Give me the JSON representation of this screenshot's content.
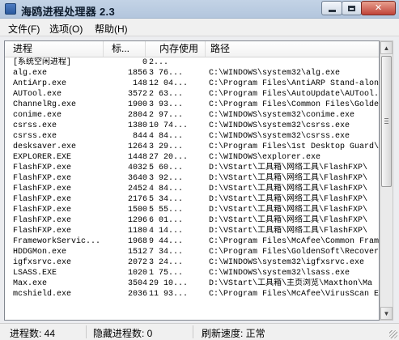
{
  "window": {
    "title": "海鸥进程处理器 2.3",
    "controls": {
      "minimize": "",
      "maximize": "",
      "close": "✕"
    }
  },
  "menu": {
    "file": "文件(F)",
    "options": "选项(O)",
    "help": "帮助(H)"
  },
  "columns": {
    "process": "进程",
    "pid": "标...",
    "memory": "内存使用",
    "path": "路径"
  },
  "rows": [
    {
      "name": "[系统空闲进程]",
      "pid": "0",
      "mem": "2...",
      "path": ""
    },
    {
      "name": "alg.exe",
      "pid": "1856",
      "mem": "3 76...",
      "path": "C:\\WINDOWS\\system32\\alg.exe"
    },
    {
      "name": "AntiArp.exe",
      "pid": "148",
      "mem": "12 04...",
      "path": "C:\\Program Files\\AntiARP Stand-alon"
    },
    {
      "name": "AUTool.exe",
      "pid": "3572",
      "mem": "2 63...",
      "path": "C:\\Program Files\\AutoUpdate\\AUTool."
    },
    {
      "name": "ChannelRg.exe",
      "pid": "1900",
      "mem": "3 93...",
      "path": "C:\\Program Files\\Common Files\\Golden"
    },
    {
      "name": "conime.exe",
      "pid": "2804",
      "mem": "2 97...",
      "path": "C:\\WINDOWS\\system32\\conime.exe"
    },
    {
      "name": "csrss.exe",
      "pid": "1380",
      "mem": "10 74...",
      "path": "C:\\WINDOWS\\system32\\csrss.exe"
    },
    {
      "name": "csrss.exe",
      "pid": "844",
      "mem": "4 84...",
      "path": "C:\\WINDOWS\\system32\\csrss.exe"
    },
    {
      "name": "desksaver.exe",
      "pid": "1264",
      "mem": "3 29...",
      "path": "C:\\Program Files\\1st Desktop Guard\\"
    },
    {
      "name": "EXPLORER.EXE",
      "pid": "1448",
      "mem": "27 20...",
      "path": "C:\\WINDOWS\\explorer.exe"
    },
    {
      "name": "FlashFXP.exe",
      "pid": "4032",
      "mem": "5 60...",
      "path": "D:\\VStart\\工具箱\\网络工具\\FlashFXP\\"
    },
    {
      "name": "FlashFXP.exe",
      "pid": "3640",
      "mem": "3 92...",
      "path": "D:\\VStart\\工具箱\\网络工具\\FlashFXP\\"
    },
    {
      "name": "FlashFXP.exe",
      "pid": "2452",
      "mem": "4 84...",
      "path": "D:\\VStart\\工具箱\\网络工具\\FlashFXP\\"
    },
    {
      "name": "FlashFXP.exe",
      "pid": "2176",
      "mem": "5 34...",
      "path": "D:\\VStart\\工具箱\\网络工具\\FlashFXP\\"
    },
    {
      "name": "FlashFXP.exe",
      "pid": "1500",
      "mem": "5 55...",
      "path": "D:\\VStart\\工具箱\\网络工具\\FlashFXP\\"
    },
    {
      "name": "FlashFXP.exe",
      "pid": "1296",
      "mem": "6 01...",
      "path": "D:\\VStart\\工具箱\\网络工具\\FlashFXP\\"
    },
    {
      "name": "FlashFXP.exe",
      "pid": "1180",
      "mem": "4 14...",
      "path": "D:\\VStart\\工具箱\\网络工具\\FlashFXP\\"
    },
    {
      "name": "FrameworkServic...",
      "pid": "1968",
      "mem": "9 44...",
      "path": "C:\\Program Files\\McAfee\\Common Frame"
    },
    {
      "name": "HDDGMon.exe",
      "pid": "1512",
      "mem": "7 34...",
      "path": "C:\\Program Files\\GoldenSoft\\Recovery"
    },
    {
      "name": "igfxsrvc.exe",
      "pid": "2072",
      "mem": "3 24...",
      "path": "C:\\WINDOWS\\system32\\igfxsrvc.exe"
    },
    {
      "name": "LSASS.EXE",
      "pid": "1020",
      "mem": "1 75...",
      "path": "C:\\WINDOWS\\system32\\lsass.exe"
    },
    {
      "name": "Max.exe",
      "pid": "3504",
      "mem": "29 10...",
      "path": "D:\\VStart\\工具箱\\主页浏览\\Maxthon\\Ma"
    },
    {
      "name": "mcshield.exe",
      "pid": "2036",
      "mem": "11 93...",
      "path": "C:\\Program Files\\McAfee\\VirusScan En"
    }
  ],
  "scrollbar": {
    "up": "▲",
    "down": "▼"
  },
  "status": {
    "process_count": "进程数: 44",
    "hidden_count": "隐藏进程数: 0",
    "refresh": "刷新速度: 正常"
  }
}
